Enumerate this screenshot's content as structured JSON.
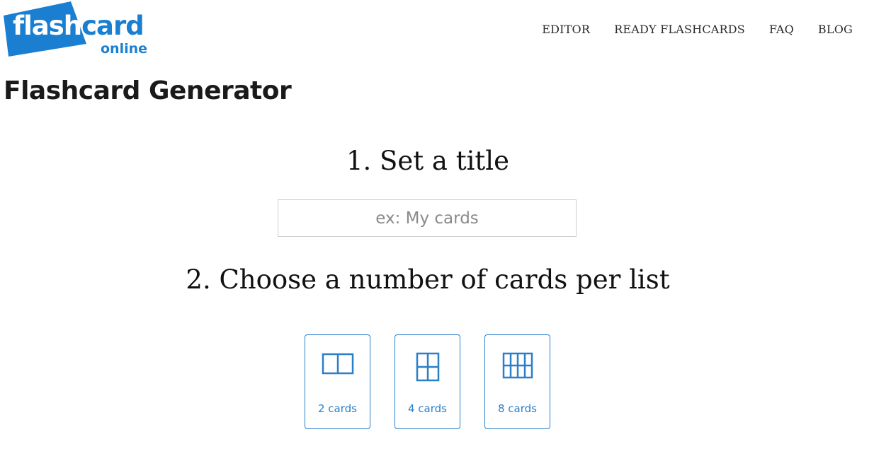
{
  "logo": {
    "part_white": "flash",
    "part_blue": "card",
    "sub": "online"
  },
  "nav": {
    "items": [
      {
        "label": "EDITOR"
      },
      {
        "label": "READY FLASHCARDS"
      },
      {
        "label": "FAQ"
      },
      {
        "label": "BLOG"
      }
    ]
  },
  "page_title": "Flashcard Generator",
  "step1": {
    "heading": "1. Set a title",
    "input_placeholder": "ex: My cards",
    "input_value": ""
  },
  "step2": {
    "heading": "2. Choose a number of cards per list",
    "options": [
      {
        "label": "2 cards",
        "icon": "two-card-layout-icon"
      },
      {
        "label": "4 cards",
        "icon": "four-card-layout-icon"
      },
      {
        "label": "8 cards",
        "icon": "eight-card-layout-icon"
      }
    ]
  },
  "colors": {
    "brand_blue": "#1a7fd0",
    "option_blue": "#2a7fc9",
    "text_dark": "#1a1a1a"
  }
}
